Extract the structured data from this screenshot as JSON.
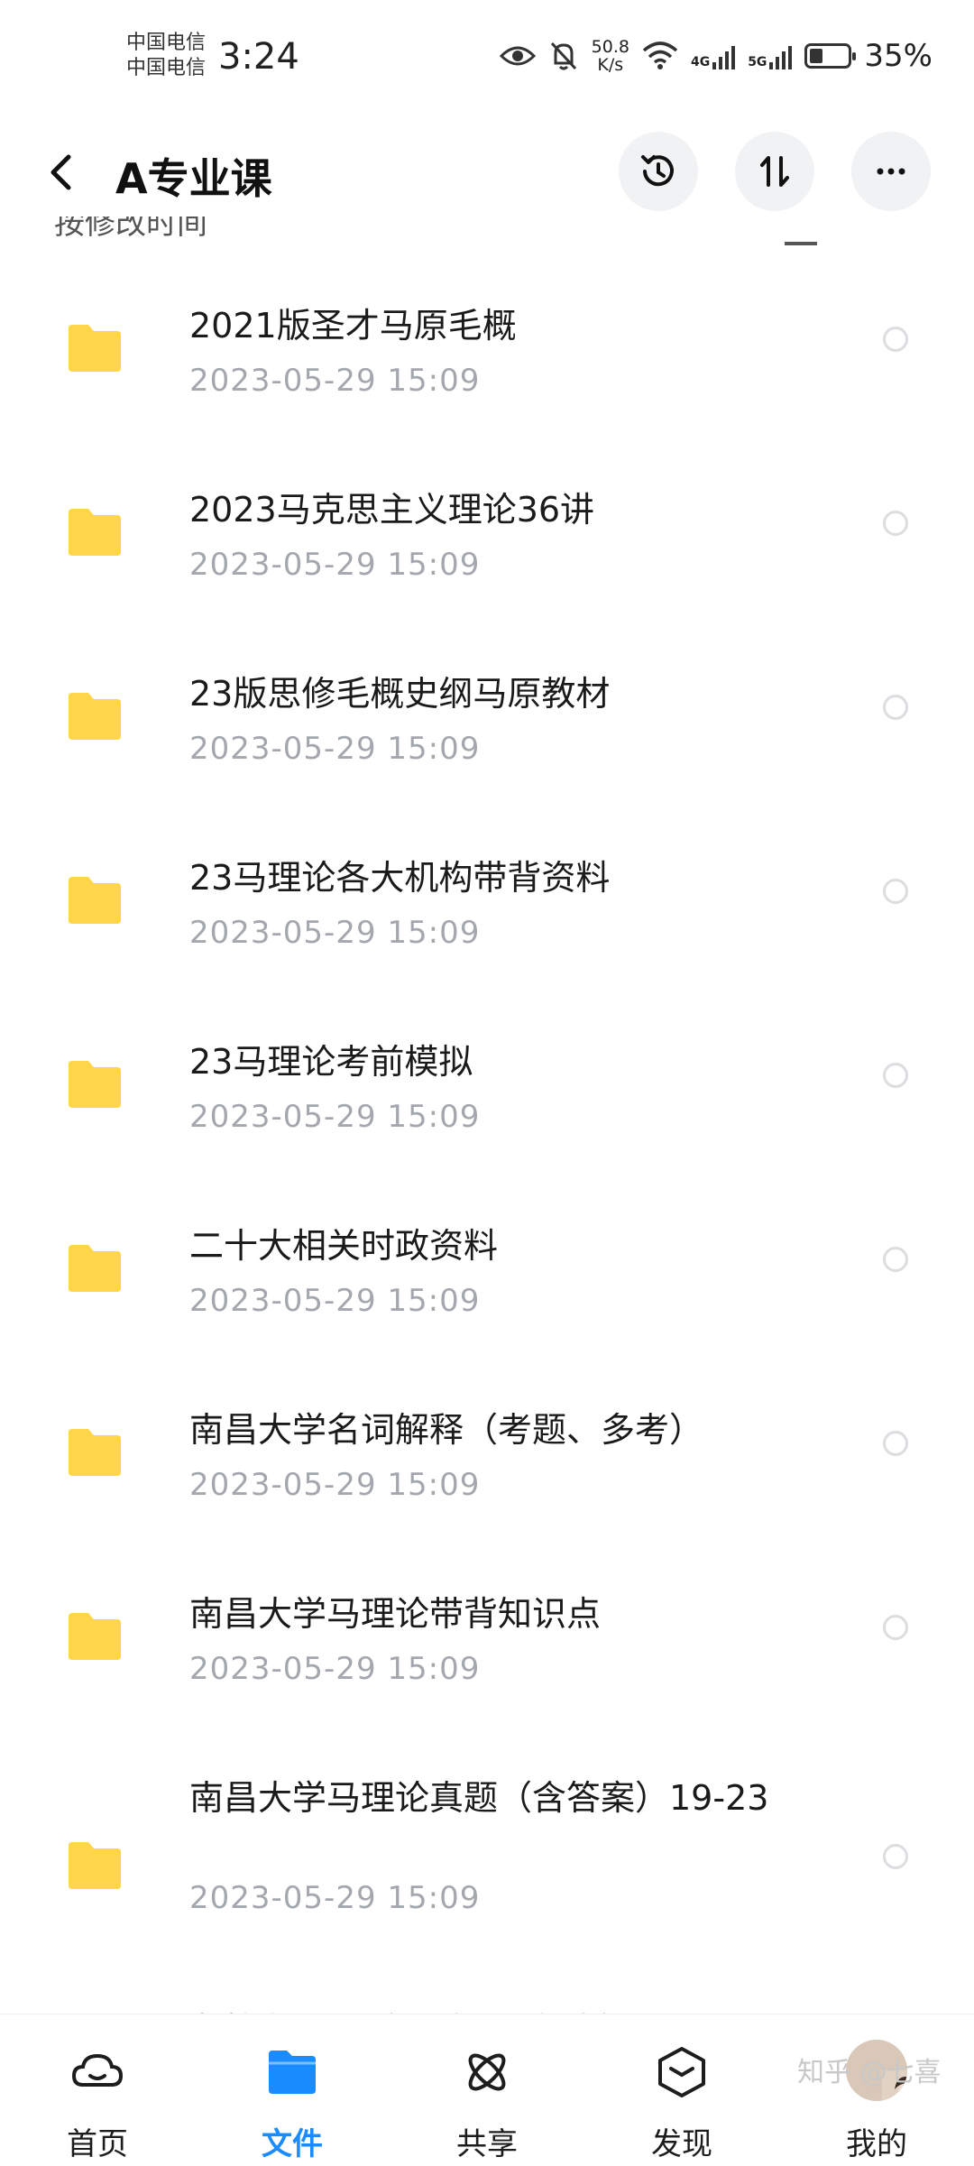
{
  "status_bar": {
    "carrier_1": "中国电信",
    "carrier_2": "中国电信",
    "time": "3:24",
    "net_speed_value": "50.8",
    "net_speed_unit": "K/s",
    "sig1_label": "4G",
    "sig2_label": "5G",
    "battery_percent_text": "35%",
    "battery_level": 0.35
  },
  "header": {
    "title": "A专业课",
    "back_icon": "chevron-left-icon",
    "history_icon": "history-icon",
    "sort_icon": "sort-icon",
    "more_icon": "more-icon"
  },
  "sort_bar_peek": "按修改时间",
  "files": [
    {
      "name": "2021版圣才马原毛概",
      "date": "2023-05-29  15:09"
    },
    {
      "name": "2023马克思主义理论36讲",
      "date": "2023-05-29  15:09"
    },
    {
      "name": "23版思修毛概史纲马原教材",
      "date": "2023-05-29  15:09"
    },
    {
      "name": "23马理论各大机构带背资料",
      "date": "2023-05-29  15:09"
    },
    {
      "name": "23马理论考前模拟",
      "date": "2023-05-29  15:09"
    },
    {
      "name": "二十大相关时政资料",
      "date": "2023-05-29  15:09"
    },
    {
      "name": "南昌大学名词解释（考题、多考）",
      "date": "2023-05-29  15:09"
    },
    {
      "name": "南昌大学马理论带背知识点",
      "date": "2023-05-29  15:09"
    },
    {
      "name": "南昌大学马理论真题（含答案）19-23",
      "date": "2023-05-29  15:09"
    },
    {
      "name": "友校参考题（江财、江师大）",
      "date": ""
    }
  ],
  "nav": {
    "home": "首页",
    "files": "文件",
    "share": "共享",
    "discover": "发现",
    "mine": "我的"
  },
  "watermark": "知乎 @七喜",
  "colors": {
    "accent": "#1a8cff",
    "folder": "#ffd54a",
    "date_gray": "#a4a8ae"
  }
}
